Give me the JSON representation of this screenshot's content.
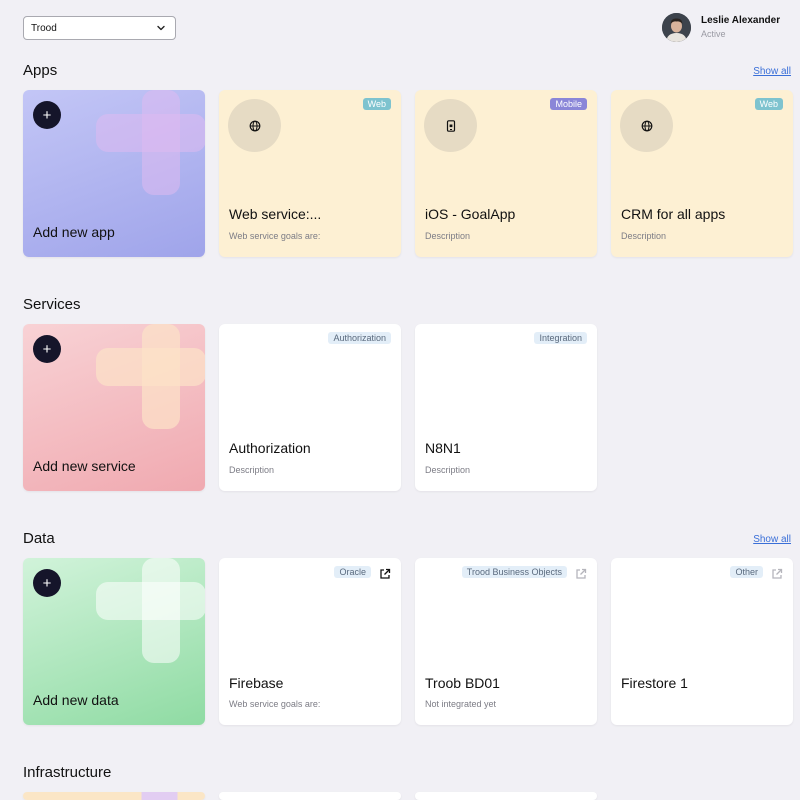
{
  "header": {
    "project_select": "Trood",
    "user": {
      "name": "Leslie Alexander",
      "status": "Active"
    }
  },
  "sections": {
    "apps": {
      "title": "Apps",
      "show_all": "Show all",
      "add_label": "Add new app",
      "cards": [
        {
          "badge": "Web",
          "icon": "globe-icon",
          "title": "Web service:...",
          "desc": "Web service goals are:"
        },
        {
          "badge": "Mobile",
          "icon": "mobile-icon",
          "title": "iOS - GoalApp",
          "desc": "Description"
        },
        {
          "badge": "Web",
          "icon": "globe-icon",
          "title": "CRM for all apps",
          "desc": "Description"
        }
      ]
    },
    "services": {
      "title": "Services",
      "add_label": "Add new service",
      "cards": [
        {
          "badge": "Authorization",
          "title": "Authorization",
          "desc": "Description"
        },
        {
          "badge": "Integration",
          "title": "N8N1",
          "desc": "Description"
        }
      ]
    },
    "data": {
      "title": "Data",
      "show_all": "Show all",
      "add_label": "Add new data",
      "cards": [
        {
          "badge": "Oracle",
          "title": "Firebase",
          "desc": "Web service goals are:",
          "link_state": "active"
        },
        {
          "badge": "Trood Business Objects",
          "title": "Troob BD01",
          "desc": "Not integrated yet",
          "link_state": "disabled"
        },
        {
          "badge": "Other",
          "title": "Firestore 1",
          "desc": "",
          "link_state": "disabled"
        }
      ]
    },
    "infrastructure": {
      "title": "Infrastructure"
    }
  },
  "colors": {
    "background": "#f1f0f5",
    "app_card": "#fdf0d3",
    "web_badge": "#7ec3cf",
    "mobile_badge": "#8a86d8",
    "link": "#3a6fd8"
  }
}
